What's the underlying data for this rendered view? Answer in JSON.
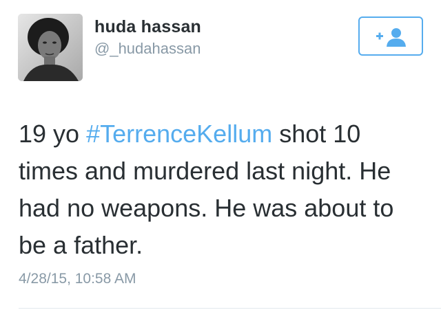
{
  "tweet": {
    "author": {
      "name": "huda hassan",
      "handle": "@_hudahassan"
    },
    "follow_button": {
      "icon": "follow-user-icon",
      "label": "+"
    },
    "text": {
      "prefix": "19 yo ",
      "hashtag": "#TerrenceKellum",
      "suffix": " shot 10 times and murdered last night. He had no weapons. He was about to be a father."
    },
    "timestamp": "4/28/15, 10:58 AM"
  },
  "colors": {
    "link": "#55acee",
    "text": "#292f33",
    "muted": "#8899a6"
  }
}
